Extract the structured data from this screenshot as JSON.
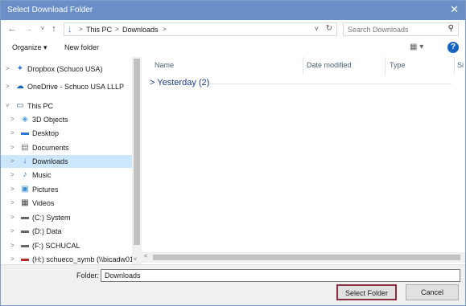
{
  "window": {
    "title": "Select Download Folder",
    "close_glyph": "✕"
  },
  "nav": {
    "back": "←",
    "forward": "→",
    "recent": "˅",
    "up": "↑",
    "breadcrumb": [
      "This PC",
      "Downloads"
    ],
    "separator": ">",
    "dropdown": "˅",
    "refresh": "↻"
  },
  "search": {
    "placeholder": "Search Downloads",
    "icon": "search-icon"
  },
  "toolbar": {
    "organize": "Organize ▾",
    "new_folder": "New folder",
    "view_glyph": "▦ ▾",
    "help_glyph": "?"
  },
  "sidebar": {
    "items": [
      {
        "label": "Dropbox (Schuco USA)",
        "icon": "dropbox-icon",
        "glyph": "✦",
        "color": "#2e76d6",
        "arrow": ">"
      },
      {
        "label": "OneDrive - Schuco USA LLLP",
        "icon": "onedrive-icon",
        "glyph": "☁",
        "color": "#1565c0",
        "arrow": ">"
      },
      {
        "label": "This PC",
        "icon": "computer-icon",
        "glyph": "▭",
        "color": "#3a6ea5",
        "arrow": "˅"
      },
      {
        "label": "3D Objects",
        "icon": "3d-objects-icon",
        "glyph": "◈",
        "color": "#4aa3df",
        "arrow": ">"
      },
      {
        "label": "Desktop",
        "icon": "desktop-icon",
        "glyph": "▬",
        "color": "#2e76d6",
        "arrow": ">"
      },
      {
        "label": "Documents",
        "icon": "documents-icon",
        "glyph": "▤",
        "color": "#777777",
        "arrow": ">"
      },
      {
        "label": "Downloads",
        "icon": "downloads-icon",
        "glyph": "↓",
        "color": "#2e76d6",
        "arrow": ">",
        "selected": true
      },
      {
        "label": "Music",
        "icon": "music-icon",
        "glyph": "♪",
        "color": "#2e76d6",
        "arrow": ">"
      },
      {
        "label": "Pictures",
        "icon": "pictures-icon",
        "glyph": "▣",
        "color": "#3a8fd6",
        "arrow": ">"
      },
      {
        "label": "Videos",
        "icon": "videos-icon",
        "glyph": "▦",
        "color": "#444444",
        "arrow": ">"
      },
      {
        "label": "(C:) System",
        "icon": "drive-icon",
        "glyph": "▬",
        "color": "#666666",
        "arrow": ">"
      },
      {
        "label": "(D:) Data",
        "icon": "drive-icon",
        "glyph": "▬",
        "color": "#666666",
        "arrow": ">"
      },
      {
        "label": "(F:) SCHUCAL",
        "icon": "drive-icon",
        "glyph": "▬",
        "color": "#666666",
        "arrow": ">"
      },
      {
        "label": "(H:) schueco_symb (\\\\bicadw01.",
        "icon": "network-drive-icon",
        "glyph": "▬",
        "color": "#b03030",
        "arrow": ">"
      }
    ]
  },
  "columns": [
    "Name",
    "Date modified",
    "Type",
    "Si"
  ],
  "group": {
    "label": "Yesterday (2)",
    "arrow": ">"
  },
  "scroll": {
    "up_down": "˅",
    "left": "<"
  },
  "footer": {
    "folder_label": "Folder:",
    "folder_value": "Downloads",
    "select_label": "Select Folder",
    "cancel_label": "Cancel"
  },
  "colors": {
    "accent": "#2e76d6",
    "title_bar": "#6a8fc7",
    "selected_row": "#cce6fb",
    "primary_border": "#8b2c3c"
  }
}
